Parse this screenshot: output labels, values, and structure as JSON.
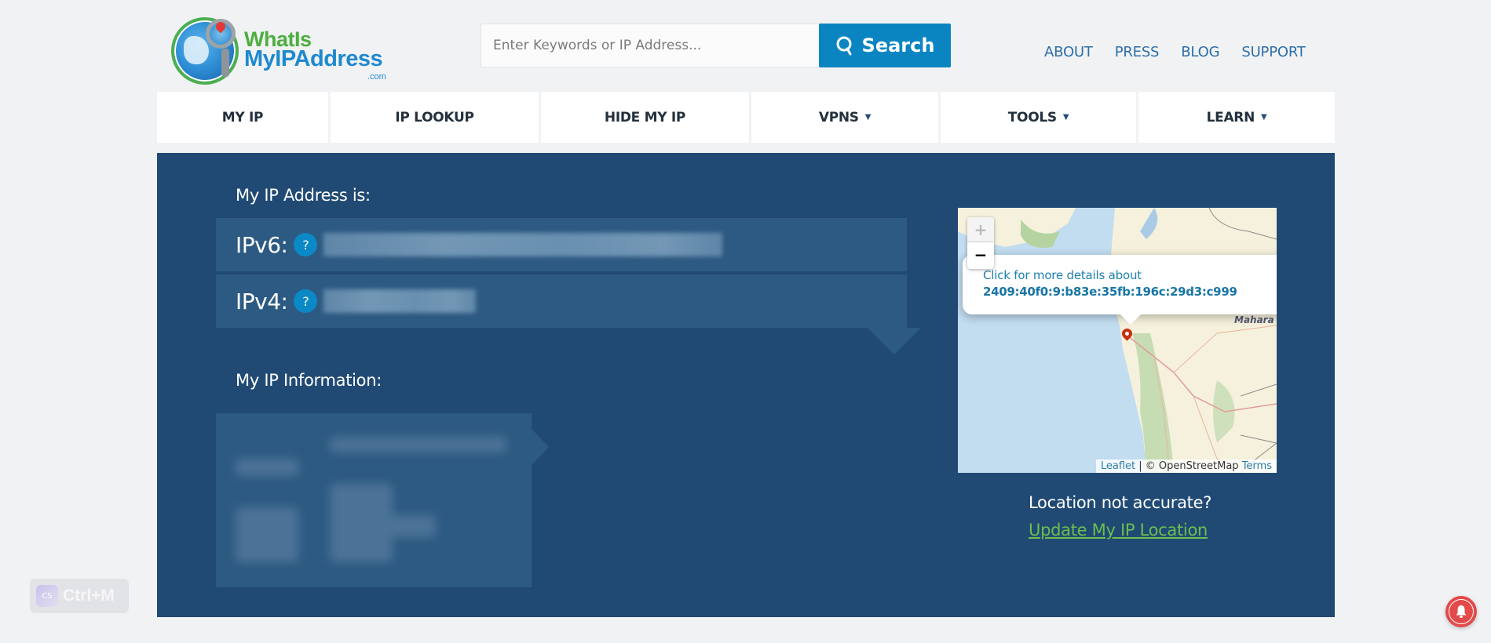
{
  "logo": {
    "line1": "WhatIs",
    "line2": "MyIPAddress",
    "line3": ".com"
  },
  "search": {
    "placeholder": "Enter Keywords or IP Address...",
    "value": "",
    "button_label": "Search",
    "icon": "search-icon"
  },
  "top_links": [
    "ABOUT",
    "PRESS",
    "BLOG",
    "SUPPORT"
  ],
  "nav": [
    {
      "label": "MY IP",
      "dropdown": false
    },
    {
      "label": "IP LOOKUP",
      "dropdown": false
    },
    {
      "label": "HIDE MY IP",
      "dropdown": false
    },
    {
      "label": "VPNS",
      "dropdown": true
    },
    {
      "label": "TOOLS",
      "dropdown": true
    },
    {
      "label": "LEARN",
      "dropdown": true
    }
  ],
  "nav_caret": "▼",
  "ip_section": {
    "heading": "My IP Address is:",
    "ipv6_label": "IPv6:",
    "ipv4_label": "IPv4:",
    "help_glyph": "?",
    "ipv6_value_redacted": true,
    "ipv4_value_redacted": true
  },
  "info_section": {
    "heading": "My IP Information:",
    "content_redacted": true
  },
  "map": {
    "zoom_in": "+",
    "zoom_out": "−",
    "popup_line1": "Click for more details about",
    "popup_line2": "2409:40f0:9:b83e:35fb:196c:29d3:c999",
    "region_label": "Mahara",
    "attribution_leaflet": "Leaflet",
    "attribution_sep": " | © OpenStreetMap ",
    "attribution_terms": "Terms"
  },
  "location": {
    "question": "Location not accurate?",
    "link": "Update My IP Location"
  },
  "extension_badge": {
    "icon_text": "CS",
    "shortcut": "Ctrl+M"
  },
  "colors": {
    "accent": "#0a85c2",
    "panel": "#204a74",
    "row": "#2d5a82",
    "link_green": "#6cbe4f",
    "nav_link": "#2d6fa8",
    "bell": "#e34a4a"
  }
}
